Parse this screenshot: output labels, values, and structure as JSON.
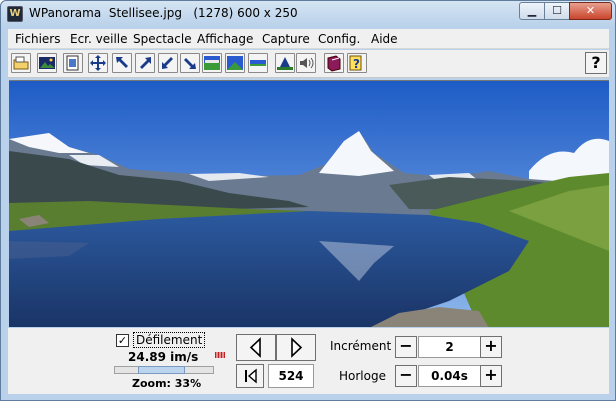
{
  "window": {
    "title": "WPanorama  Stellisee.jpg   (1278) 600 x 250",
    "app_icon_glyph": "W"
  },
  "menu": {
    "items": [
      "Fichiers",
      "Ecr. veille",
      "Spectacle",
      "Affichage",
      "Capture",
      "Config.",
      "Aide"
    ]
  },
  "toolbar": {
    "icons": [
      "open-folder-icon",
      "image-icon",
      "fit-page-icon",
      "expand-icon",
      "arrow-up-left-icon",
      "arrow-up-right-icon",
      "arrow-down-left-icon",
      "arrow-down-right-icon",
      "panorama-wide-icon",
      "panorama-narrow-icon",
      "panorama-thin-icon",
      "landscape-icon",
      "sound-icon",
      "book-icon",
      "help-topic-icon"
    ],
    "help_label": "?"
  },
  "controls": {
    "scroll_checkbox_checked": true,
    "scroll_checkbox_mark": "✓",
    "scroll_label": "Défilement",
    "speed": "24.89 im/s",
    "speed_slider_fraction": 0.45,
    "zoom": "Zoom: 33%",
    "frame_counter": "524",
    "increment_label": "Incrément",
    "increment_value": "2",
    "clock_label": "Horloge",
    "clock_value": "0.04s",
    "minus_label": "−",
    "plus_label": "+"
  },
  "colors": {
    "sky_top": "#1e5cc6",
    "sky_bottom": "#8fb8ec",
    "lake": "#1f3f7a",
    "grass": "#5e8a2e"
  }
}
